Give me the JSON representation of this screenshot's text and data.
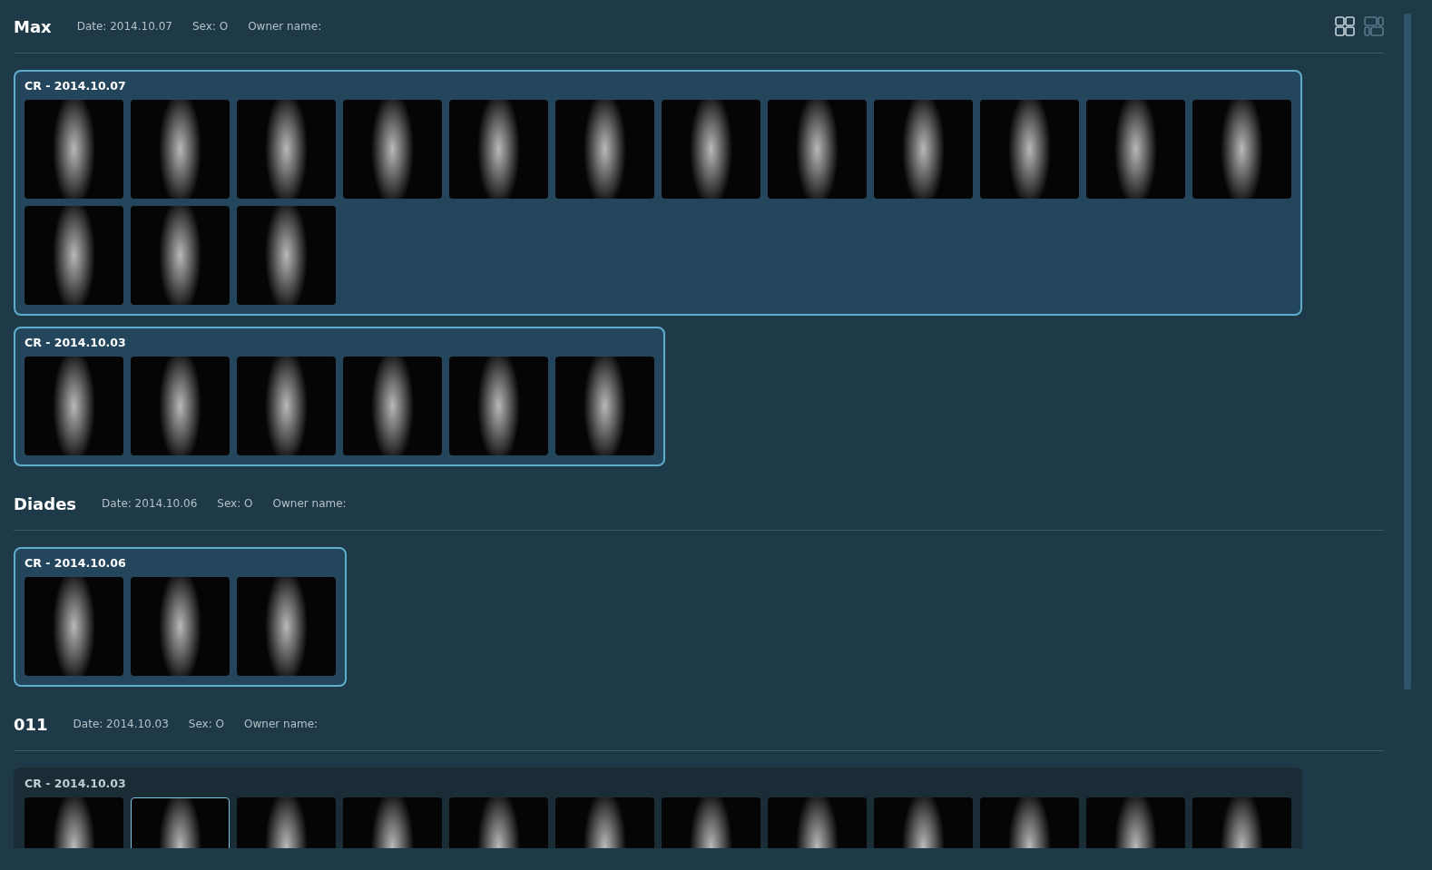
{
  "view_buttons": [
    {
      "kind": "grid",
      "selected": true
    },
    {
      "kind": "mosaic",
      "selected": false
    }
  ],
  "patients": [
    {
      "name": "Max",
      "date": "Date: 2014.10.07",
      "sex": "Sex: O",
      "owner": "Owner name:",
      "studies": [
        {
          "title": "CR - 2014.10.07",
          "selected": true,
          "images": [
            {
              "selected": false
            },
            {
              "selected": false
            },
            {
              "selected": false
            },
            {
              "selected": false
            },
            {
              "selected": false
            },
            {
              "selected": false
            },
            {
              "selected": false
            },
            {
              "selected": false
            },
            {
              "selected": false
            },
            {
              "selected": false
            },
            {
              "selected": false
            },
            {
              "selected": false
            },
            {
              "selected": false
            },
            {
              "selected": false
            },
            {
              "selected": false
            }
          ]
        },
        {
          "title": "CR - 2014.10.03",
          "selected": true,
          "images": [
            {
              "selected": false
            },
            {
              "selected": false
            },
            {
              "selected": false
            },
            {
              "selected": false
            },
            {
              "selected": false
            },
            {
              "selected": false
            }
          ]
        }
      ]
    },
    {
      "name": "Diades",
      "date": "Date: 2014.10.06",
      "sex": "Sex: O",
      "owner": "Owner name:",
      "studies": [
        {
          "title": "CR - 2014.10.06",
          "selected": true,
          "images": [
            {
              "selected": false
            },
            {
              "selected": false
            },
            {
              "selected": false
            }
          ]
        }
      ]
    },
    {
      "name": "011",
      "date": "Date: 2014.10.03",
      "sex": "Sex: O",
      "owner": "Owner name:",
      "studies": [
        {
          "title": "CR - 2014.10.03",
          "selected": false,
          "images": [
            {
              "selected": false
            },
            {
              "selected": true
            },
            {
              "selected": false
            },
            {
              "selected": false
            },
            {
              "selected": false
            },
            {
              "selected": false
            },
            {
              "selected": false
            },
            {
              "selected": false
            },
            {
              "selected": false
            },
            {
              "selected": false
            },
            {
              "selected": false
            },
            {
              "selected": false
            }
          ]
        }
      ]
    }
  ]
}
